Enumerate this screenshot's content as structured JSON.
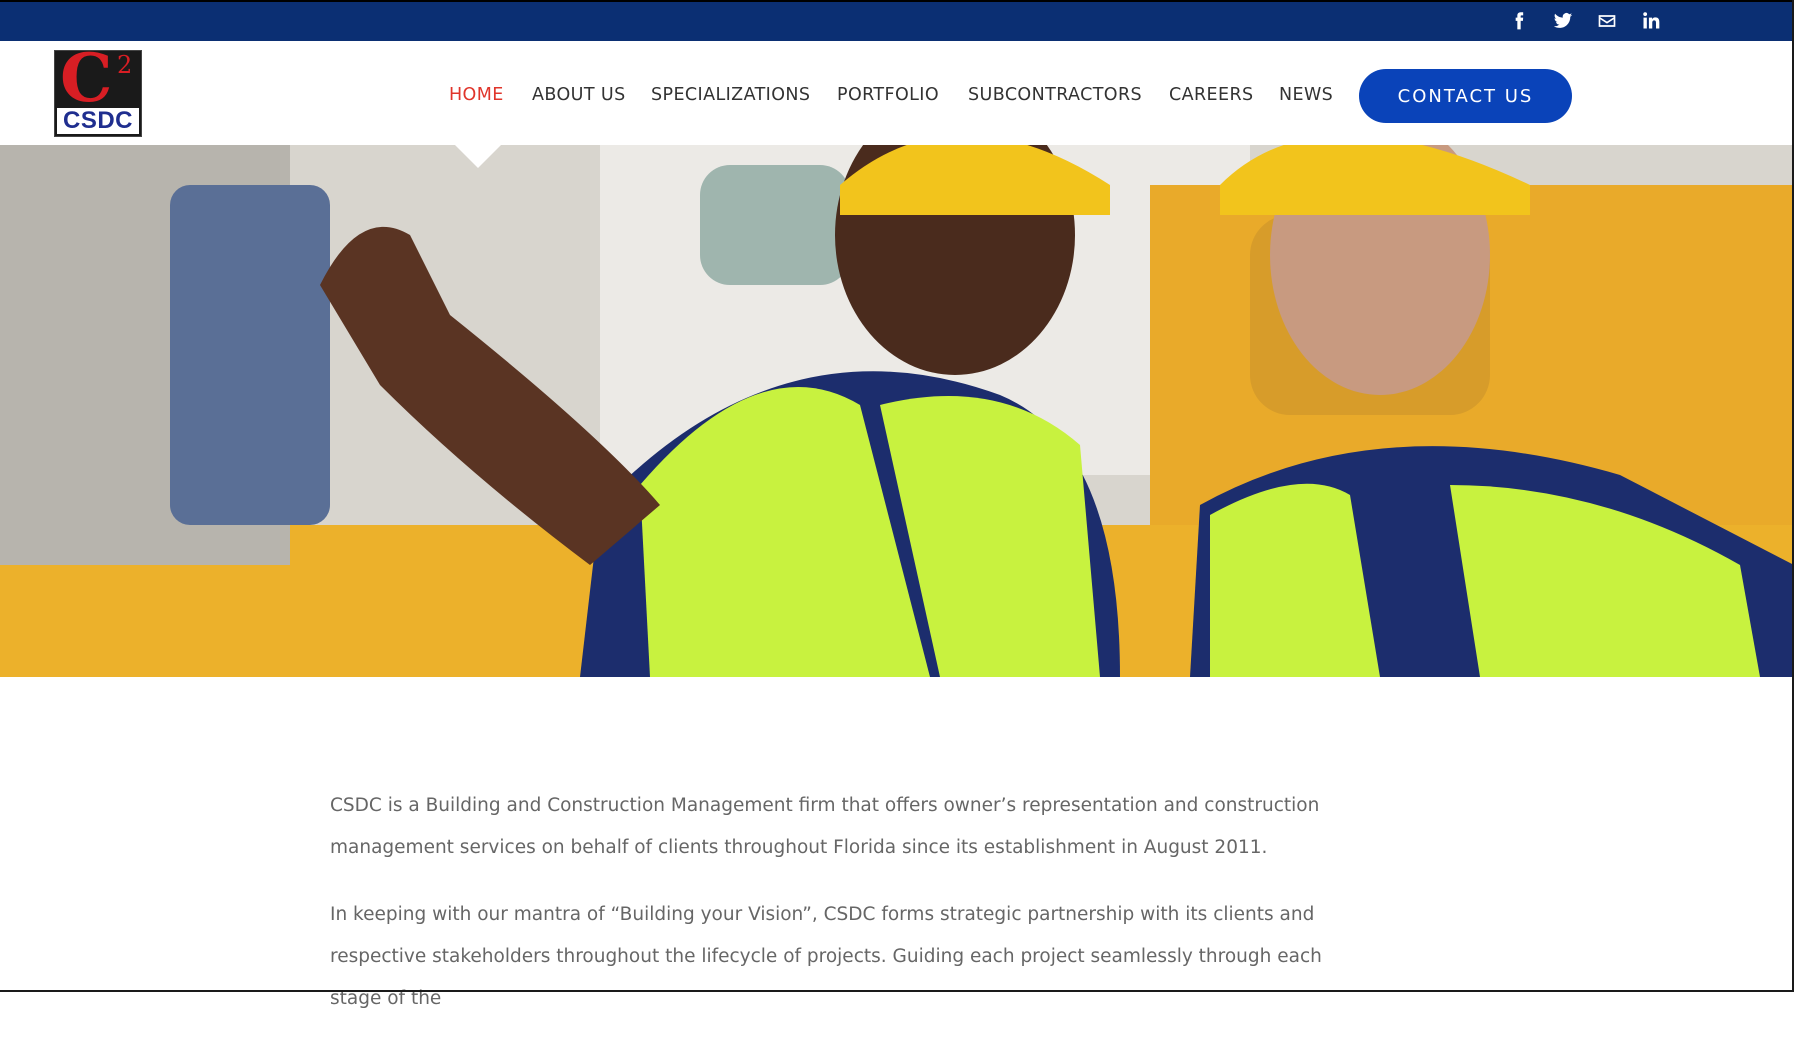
{
  "topbar": {
    "social_icons": [
      "facebook-icon",
      "twitter-icon",
      "email-icon",
      "linkedin-icon"
    ],
    "background_color": "#0b2f73"
  },
  "logo": {
    "letter": "C",
    "superscript": "2",
    "text": "CSDC"
  },
  "nav": {
    "items": [
      {
        "label": "HOME",
        "active": true
      },
      {
        "label": "ABOUT US",
        "active": false
      },
      {
        "label": "SPECIALIZATIONS",
        "active": false
      },
      {
        "label": "PORTFOLIO",
        "active": false
      },
      {
        "label": "SUBCONTRACTORS",
        "active": false
      },
      {
        "label": "CAREERS",
        "active": false
      },
      {
        "label": "NEWS",
        "active": false
      }
    ],
    "active_color": "#e0352b",
    "contact_label": "CONTACT US",
    "contact_color": "#0a43b9"
  },
  "hero": {
    "image": "construction-workers-hard-hats-photo"
  },
  "content": {
    "paragraphs": [
      "CSDC is a Building and Construction Management firm that offers owner’s representation and construction management services on behalf of clients throughout Florida since its establishment in August 2011.",
      "In keeping with our mantra of “Building your Vision”, CSDC forms strategic partnership with its clients and respective stakeholders throughout the lifecycle of projects. Guiding each project seamlessly through each stage of the"
    ]
  }
}
